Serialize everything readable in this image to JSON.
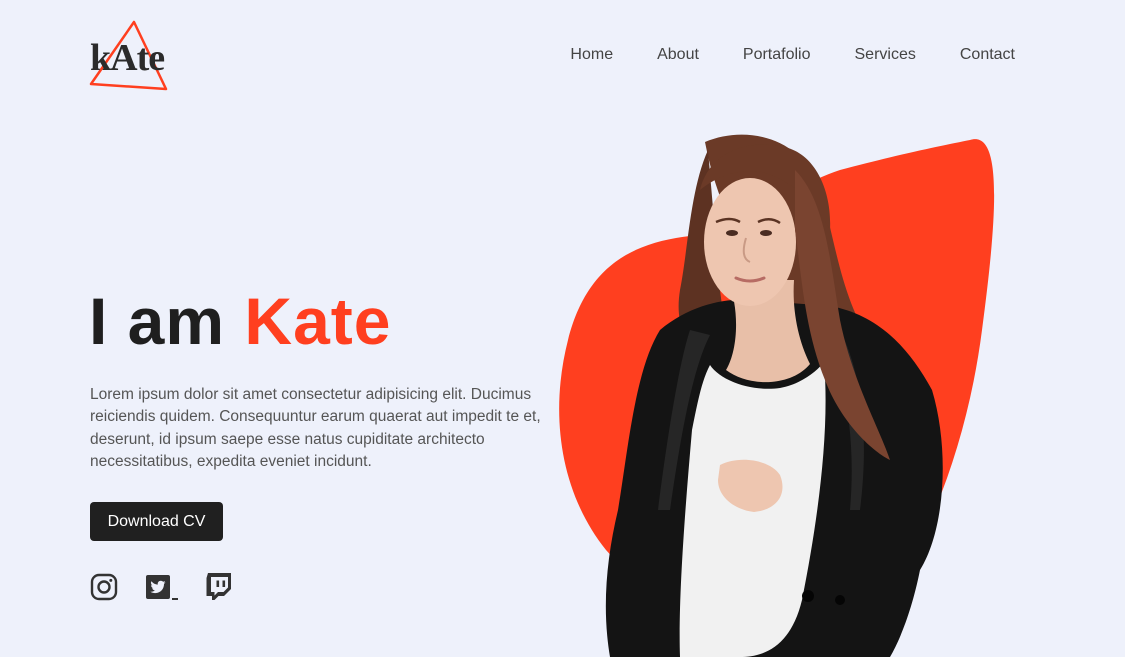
{
  "brand": {
    "logo_text": "kAte",
    "accent_color": "#ff3f1f",
    "dark_color": "#202020"
  },
  "nav": {
    "items": [
      {
        "label": "Home"
      },
      {
        "label": "About"
      },
      {
        "label": "Portafolio"
      },
      {
        "label": "Services"
      },
      {
        "label": "Contact"
      }
    ]
  },
  "hero": {
    "headline_prefix": "I am ",
    "headline_name": "Kate",
    "intro": "Lorem ipsum dolor sit amet consectetur adipisicing elit. Ducimus reiciendis quidem. Consequuntur earum quaerat aut impedit te et, deserunt, id ipsum saepe esse natus cupiditate architecto necessitatibus, expedita eveniet incidunt.",
    "cta_label": "Download CV",
    "image_icon": "portrait-photo"
  },
  "social": {
    "icons": [
      "instagram-icon",
      "twitter-icon",
      "twitch-icon"
    ]
  }
}
